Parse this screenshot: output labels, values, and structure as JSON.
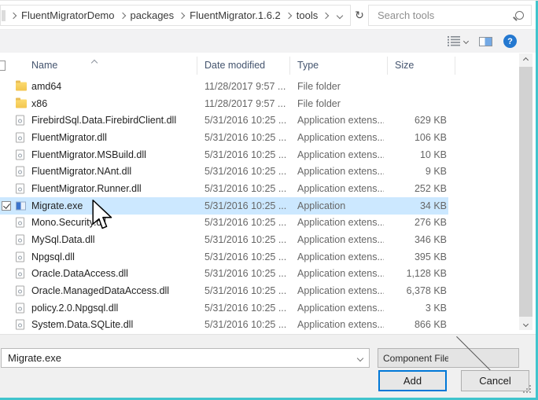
{
  "window": {
    "accent_border_color": "#41c4cd",
    "selection_color": "#cce8ff"
  },
  "address_bar": {
    "breadcrumbs": [
      {
        "label": "FluentMigratorDemo"
      },
      {
        "label": "packages"
      },
      {
        "label": "FluentMigrator.1.6.2"
      },
      {
        "label": "tools"
      }
    ],
    "refresh_glyph": "↻",
    "search": {
      "placeholder": "Search tools"
    }
  },
  "toolbar": {
    "help_label": "?"
  },
  "file_list": {
    "columns": [
      {
        "label": "Name"
      },
      {
        "label": "Date modified"
      },
      {
        "label": "Type"
      },
      {
        "label": "Size"
      }
    ],
    "sorted_by": "Name",
    "sort_ascending": true,
    "rows": [
      {
        "name": "amd64",
        "date": "11/28/2017 9:57 ...",
        "type": "File folder",
        "size": "",
        "icon": "folder",
        "selected": false,
        "checked": false
      },
      {
        "name": "x86",
        "date": "11/28/2017 9:57 ...",
        "type": "File folder",
        "size": "",
        "icon": "folder",
        "selected": false,
        "checked": false
      },
      {
        "name": "FirebirdSql.Data.FirebirdClient.dll",
        "date": "5/31/2016 10:25 ...",
        "type": "Application extens...",
        "size": "629 KB",
        "icon": "dll",
        "selected": false,
        "checked": false
      },
      {
        "name": "FluentMigrator.dll",
        "date": "5/31/2016 10:25 ...",
        "type": "Application extens...",
        "size": "106 KB",
        "icon": "dll",
        "selected": false,
        "checked": false
      },
      {
        "name": "FluentMigrator.MSBuild.dll",
        "date": "5/31/2016 10:25 ...",
        "type": "Application extens...",
        "size": "10 KB",
        "icon": "dll",
        "selected": false,
        "checked": false
      },
      {
        "name": "FluentMigrator.NAnt.dll",
        "date": "5/31/2016 10:25 ...",
        "type": "Application extens...",
        "size": "9 KB",
        "icon": "dll",
        "selected": false,
        "checked": false
      },
      {
        "name": "FluentMigrator.Runner.dll",
        "date": "5/31/2016 10:25 ...",
        "type": "Application extens...",
        "size": "252 KB",
        "icon": "dll",
        "selected": false,
        "checked": false
      },
      {
        "name": "Migrate.exe",
        "date": "5/31/2016 10:25 ...",
        "type": "Application",
        "size": "34 KB",
        "icon": "app",
        "selected": true,
        "checked": true
      },
      {
        "name": "Mono.Security.dll",
        "date": "5/31/2016 10:25 ...",
        "type": "Application extens...",
        "size": "276 KB",
        "icon": "dll",
        "selected": false,
        "checked": false
      },
      {
        "name": "MySql.Data.dll",
        "date": "5/31/2016 10:25 ...",
        "type": "Application extens...",
        "size": "346 KB",
        "icon": "dll",
        "selected": false,
        "checked": false
      },
      {
        "name": "Npgsql.dll",
        "date": "5/31/2016 10:25 ...",
        "type": "Application extens...",
        "size": "395 KB",
        "icon": "dll",
        "selected": false,
        "checked": false
      },
      {
        "name": "Oracle.DataAccess.dll",
        "date": "5/31/2016 10:25 ...",
        "type": "Application extens...",
        "size": "1,128 KB",
        "icon": "dll",
        "selected": false,
        "checked": false
      },
      {
        "name": "Oracle.ManagedDataAccess.dll",
        "date": "5/31/2016 10:25 ...",
        "type": "Application extens...",
        "size": "6,378 KB",
        "icon": "dll",
        "selected": false,
        "checked": false
      },
      {
        "name": "policy.2.0.Npgsql.dll",
        "date": "5/31/2016 10:25 ...",
        "type": "Application extens...",
        "size": "3 KB",
        "icon": "dll",
        "selected": false,
        "checked": false
      },
      {
        "name": "System.Data.SQLite.dll",
        "date": "5/31/2016 10:25 ...",
        "type": "Application extens...",
        "size": "866 KB",
        "icon": "dll",
        "selected": false,
        "checked": false
      }
    ]
  },
  "footer": {
    "filename": {
      "value": "Migrate.exe"
    },
    "filetype": {
      "value": "Component Files (*.dll;*.tlb;*.olb"
    },
    "add_label": "Add",
    "cancel_label": "Cancel"
  }
}
